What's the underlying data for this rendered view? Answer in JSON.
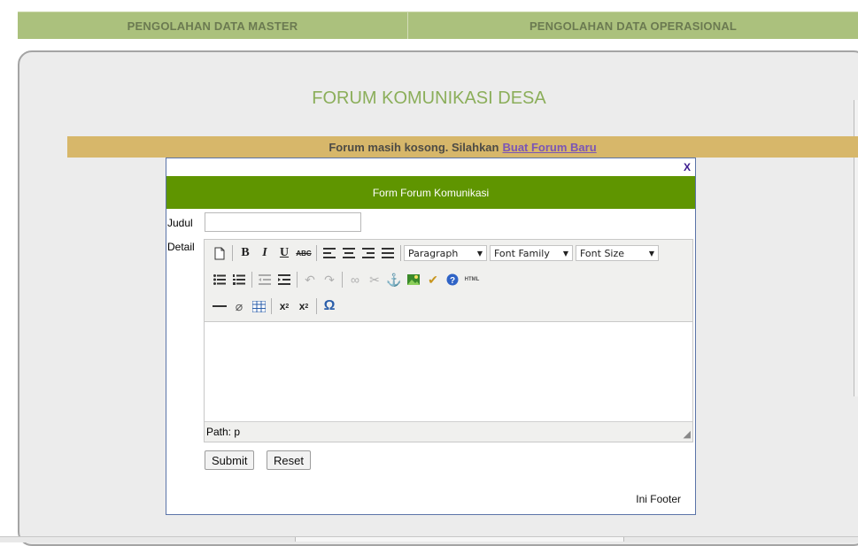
{
  "nav": {
    "master": "PENGOLAHAN DATA MASTER",
    "operasional": "PENGOLAHAN DATA OPERASIONAL"
  },
  "page": {
    "title": "FORUM KOMUNIKASI DESA"
  },
  "notice": {
    "text": "Forum masih kosong. Silahkan",
    "link": "Buat Forum Baru"
  },
  "modal": {
    "close": "X",
    "header": "Form Forum Komunikasi",
    "judul_label": "Judul",
    "judul_value": "",
    "detail_label": "Detail",
    "editor": {
      "format_select": "Paragraph",
      "font_family_select": "Font Family",
      "font_size_select": "Font Size",
      "path": "Path: p"
    },
    "submit_label": "Submit",
    "reset_label": "Reset",
    "footer": "Ini Footer"
  },
  "colors": {
    "nav_bg": "#abc17d",
    "title": "#8bae5a",
    "notice_bg": "#d7b76a",
    "modal_header_bg": "#5f9500"
  },
  "icons": [
    "new-document-icon",
    "bold-icon",
    "italic-icon",
    "underline-icon",
    "strikethrough-icon",
    "align-left-icon",
    "align-center-icon",
    "align-right-icon",
    "align-justify-icon",
    "bullet-list-icon",
    "numbered-list-icon",
    "outdent-icon",
    "indent-icon",
    "undo-icon",
    "redo-icon",
    "link-icon",
    "unlink-icon",
    "anchor-icon",
    "image-icon",
    "cleanup-icon",
    "help-icon",
    "html-icon",
    "horizontal-rule-icon",
    "eraser-icon",
    "table-icon",
    "subscript-icon",
    "superscript-icon",
    "omega-icon"
  ]
}
